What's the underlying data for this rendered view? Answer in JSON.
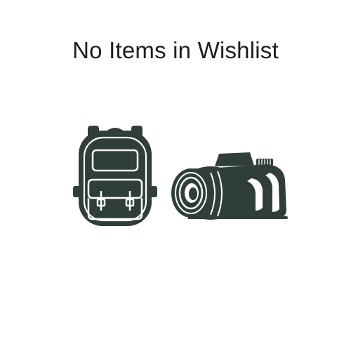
{
  "empty_state": {
    "message": "No Items in Wishlist"
  },
  "icons": {
    "left": "backpack-icon",
    "right": "camera-icon"
  },
  "colors": {
    "background": "#ffffff",
    "text": "#1e1e1e",
    "icon_fill": "#2f3f38",
    "icon_inner": "#ffffff"
  }
}
